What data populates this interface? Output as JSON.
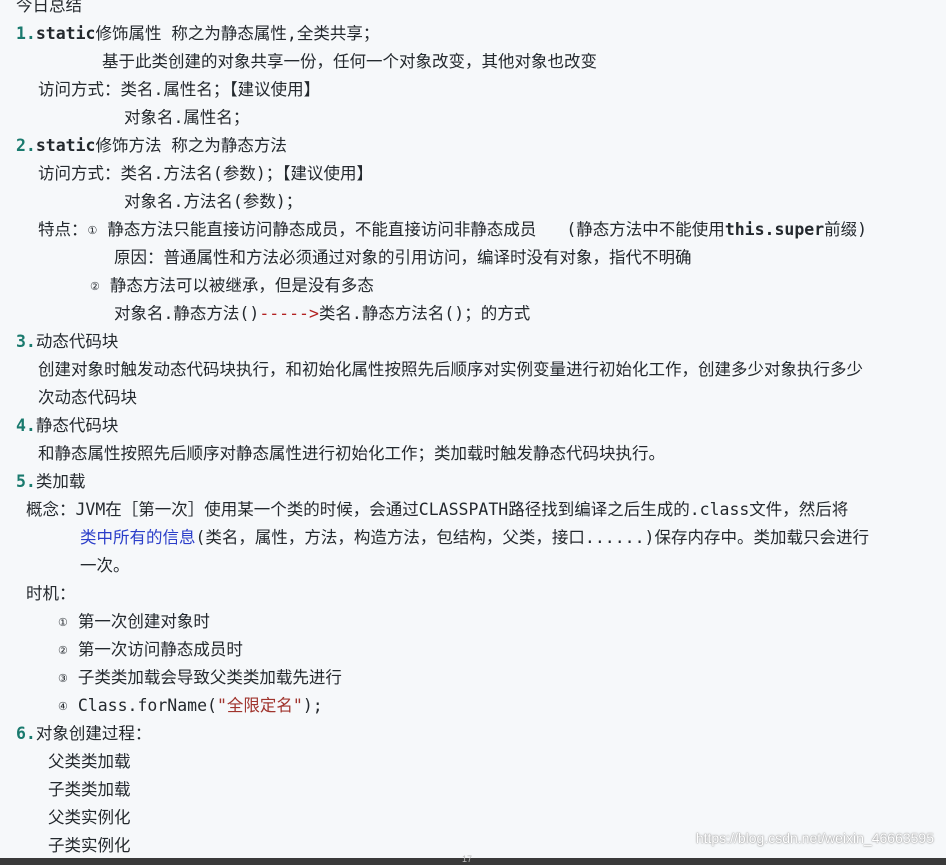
{
  "title": "今日总结",
  "s1": {
    "num": "1.",
    "kw": "static",
    "heading": "修饰属性 称之为静态属性,全类共享；",
    "desc": "基于此类创建的对象共享一份，任何一个对象改变，其他对象也改变",
    "access1": "访问方式：类名.属性名；【建议使用】",
    "access2": "对象名.属性名；"
  },
  "s2": {
    "num": "2.",
    "kw": "static",
    "heading": "修饰方法 称之为静态方法",
    "access1": "访问方式：类名.方法名(参数)；【建议使用】",
    "access2": "对象名.方法名(参数)；",
    "feature_label": "特点：",
    "mark1": "①",
    "feature1": "静态方法只能直接访问静态成员，不能直接访问非静态成员",
    "feature1_note_prefix": "(静态方法中不能使用",
    "feature1_note_kw": "this.super",
    "feature1_note_suffix": "前缀)",
    "reason": "原因：普通属性和方法必须通过对象的引用访问，编译时没有对象，指代不明确",
    "mark2": "②",
    "feature2": "静态方法可以被继承，但是没有多态",
    "call_left": "对象名.静态方法()",
    "call_arrow": "----->",
    "call_right": "类名.静态方法名()；的方式"
  },
  "s3": {
    "num": "3.",
    "heading": "动态代码块",
    "line1": "创建对象时触发动态代码块执行，和初始化属性按照先后顺序对实例变量进行初始化工作，创建多少对象执行多少",
    "line2": "次动态代码块"
  },
  "s4": {
    "num": "4.",
    "heading": "静态代码块",
    "line1": "和静态属性按照先后顺序对静态属性进行初始化工作；类加载时触发静态代码块执行。"
  },
  "s5": {
    "num": "5.",
    "heading": "类加载",
    "concept_a": "概念：JVM在［第一次］使用某一个类的时候，会通过CLASSPATH路径找到编译之后生成的.class文件，然后将",
    "concept_link": "类中所有的信息",
    "concept_b": "(类名，属性，方法，构造方法，包结构，父类，接口......)保存内存中。类加载只会进行",
    "concept_c": "一次。",
    "timing_label": "时机：",
    "t1_mark": "①",
    "t1": "第一次创建对象时",
    "t2_mark": "②",
    "t2": "第一次访问静态成员时",
    "t3_mark": "③",
    "t3": "子类类加载会导致父类类加载先进行",
    "t4_mark": "④",
    "t4_code": "Class.forName(",
    "t4_str": "\"全限定名\"",
    "t4_end": ");"
  },
  "s6": {
    "num": "6.",
    "heading": "对象创建过程：",
    "steps": [
      "父类类加载",
      "子类类加载",
      "父类实例化",
      "子类实例化"
    ]
  },
  "watermark": "https://blog.csdn.net/weixin_46663595",
  "footer": "17"
}
